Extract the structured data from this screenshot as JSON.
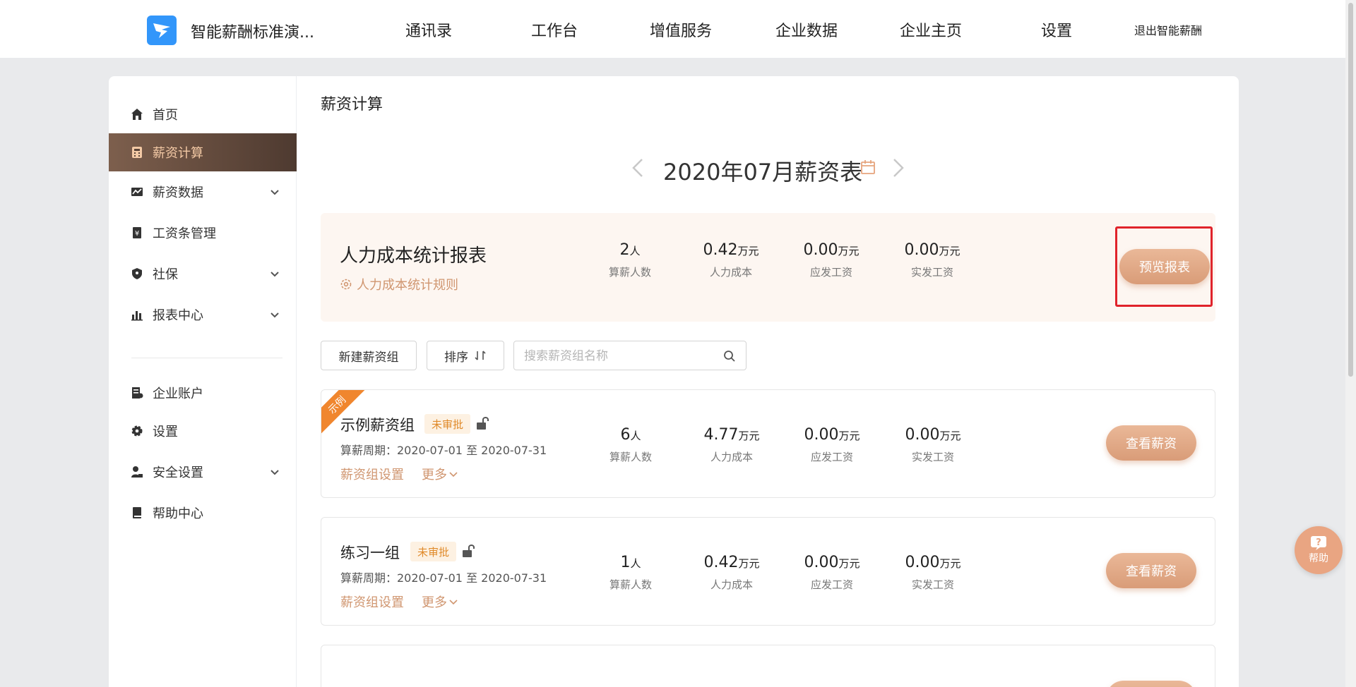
{
  "app": {
    "title": "智能薪酬标准演..."
  },
  "nav": [
    "通讯录",
    "工作台",
    "增值服务",
    "企业数据",
    "企业主页",
    "设置"
  ],
  "nav_exit": "退出智能薪酬",
  "sidebar": {
    "items": [
      {
        "label": "首页"
      },
      {
        "label": "薪资计算"
      },
      {
        "label": "薪资数据"
      },
      {
        "label": "工资条管理"
      },
      {
        "label": "社保"
      },
      {
        "label": "报表中心"
      },
      {
        "label": "企业账户"
      },
      {
        "label": "设置"
      },
      {
        "label": "安全设置"
      },
      {
        "label": "帮助中心"
      }
    ]
  },
  "page": {
    "title": "薪资计算",
    "month_title": "2020年07月薪资表"
  },
  "report": {
    "title": "人力成本统计报表",
    "rule_link": "人力成本统计规则",
    "stats": [
      {
        "value": "2",
        "unit": "人",
        "label": "算薪人数"
      },
      {
        "value": "0.42",
        "unit": "万元",
        "label": "人力成本"
      },
      {
        "value": "0.00",
        "unit": "万元",
        "label": "应发工资"
      },
      {
        "value": "0.00",
        "unit": "万元",
        "label": "实发工资"
      }
    ],
    "button": "预览报表"
  },
  "toolbar": {
    "new_group": "新建薪资组",
    "sort": "排序",
    "search_placeholder": "搜索薪资组名称"
  },
  "groups": [
    {
      "ribbon": "示例",
      "name": "示例薪资组",
      "status": "未审批",
      "period": "算薪周期：2020-07-01 至 2020-07-31",
      "settings_link": "薪资组设置",
      "more_link": "更多",
      "stats": [
        {
          "value": "6",
          "unit": "人",
          "label": "算薪人数"
        },
        {
          "value": "4.77",
          "unit": "万元",
          "label": "人力成本"
        },
        {
          "value": "0.00",
          "unit": "万元",
          "label": "应发工资"
        },
        {
          "value": "0.00",
          "unit": "万元",
          "label": "实发工资"
        }
      ],
      "button": "查看薪资"
    },
    {
      "name": "练习一组",
      "status": "未审批",
      "period": "算薪周期：2020-07-01 至 2020-07-31",
      "settings_link": "薪资组设置",
      "more_link": "更多",
      "stats": [
        {
          "value": "1",
          "unit": "人",
          "label": "算薪人数"
        },
        {
          "value": "0.42",
          "unit": "万元",
          "label": "人力成本"
        },
        {
          "value": "0.00",
          "unit": "万元",
          "label": "应发工资"
        },
        {
          "value": "0.00",
          "unit": "万元",
          "label": "实发工资"
        }
      ],
      "button": "查看薪资"
    }
  ],
  "help": {
    "label": "帮助"
  },
  "colors": {
    "accent": "#d99c78",
    "active_menu": "#5a4438",
    "highlight": "#e0232b"
  }
}
